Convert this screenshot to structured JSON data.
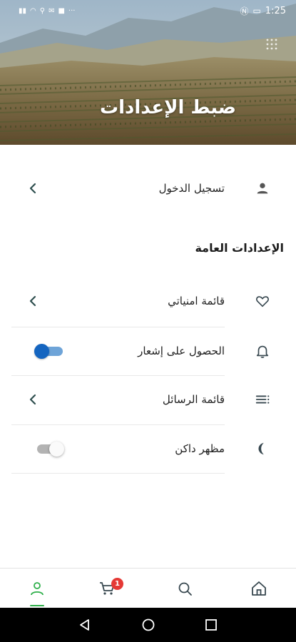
{
  "status_bar": {
    "time": "1:25",
    "left_icons": [
      "signal-icon",
      "wifi-icon",
      "usb-icon",
      "message-icon",
      "app-icon",
      "more-icon"
    ],
    "right_icons": [
      "nfc-icon",
      "battery-icon"
    ]
  },
  "header": {
    "title": "ضبط الإعدادات"
  },
  "login": {
    "label": "تسجيل الدخول",
    "icon": "person-icon"
  },
  "general_settings": {
    "title": "الإعدادات العامة",
    "items": [
      {
        "label": "قائمة امنياتي",
        "icon": "heart-icon",
        "control": "chevron"
      },
      {
        "label": "الحصول على إشعار",
        "icon": "bell-icon",
        "control": "toggle",
        "enabled": true
      },
      {
        "label": "قائمة الرسائل",
        "icon": "list-icon",
        "control": "chevron"
      },
      {
        "label": "مظهر داكن",
        "icon": "moon-icon",
        "control": "toggle",
        "enabled": false
      }
    ]
  },
  "bottom_nav": {
    "items": [
      "profile-icon",
      "cart-icon",
      "search-icon",
      "home-icon"
    ],
    "active": "profile-icon",
    "cart_badge": "1"
  },
  "colors": {
    "accent_green": "#2eaf4a",
    "toggle_on": "#1565c0",
    "badge": "#e53935",
    "icon_dark": "#37474f"
  }
}
